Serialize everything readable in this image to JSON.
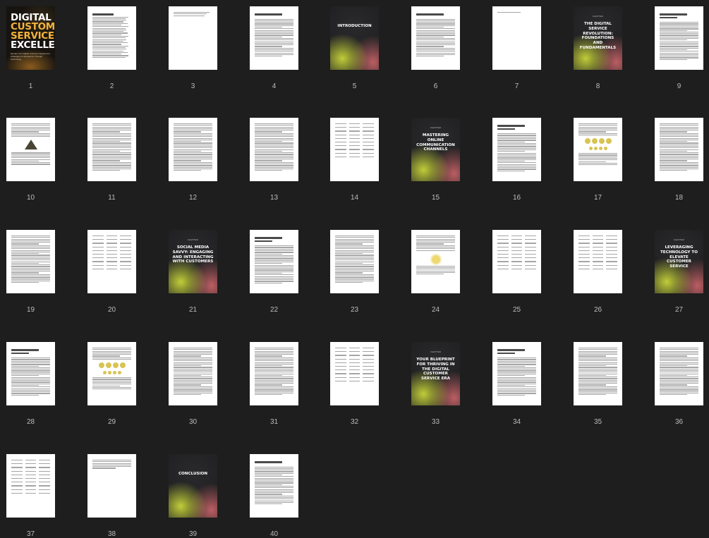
{
  "cover": {
    "title_line1": "DIGITAL",
    "title_line2": "CUSTOMER",
    "title_line3": "SERVICE",
    "title_line4": "EXCELLENCE",
    "subtitle": "Elevate Your Digital Customer Experience: Strategies for Excellence Through Technology"
  },
  "chapter_label": "CHAPTER",
  "pages": [
    {
      "number": "1",
      "kind": "cover"
    },
    {
      "number": "2",
      "kind": "toc",
      "heading": "Table of Contents"
    },
    {
      "number": "3",
      "kind": "toc-cont"
    },
    {
      "number": "4",
      "kind": "text",
      "heading": "Disclaimer"
    },
    {
      "number": "5",
      "kind": "dark",
      "title": "INTRODUCTION"
    },
    {
      "number": "6",
      "kind": "text",
      "heading": "Introduction"
    },
    {
      "number": "7",
      "kind": "blank-line"
    },
    {
      "number": "8",
      "kind": "dark",
      "title": "THE DIGITAL SERVICE REVOLUTION: FOUNDATIONS AND FUNDAMENTALS"
    },
    {
      "number": "9",
      "kind": "text",
      "heading": "The Digital Service Revolution: Foundations and Fundamentals"
    },
    {
      "number": "10",
      "kind": "figure-tri"
    },
    {
      "number": "11",
      "kind": "text"
    },
    {
      "number": "12",
      "kind": "text"
    },
    {
      "number": "13",
      "kind": "text"
    },
    {
      "number": "14",
      "kind": "table"
    },
    {
      "number": "15",
      "kind": "dark",
      "title": "MASTERING ONLINE COMMUNICATION CHANNELS"
    },
    {
      "number": "16",
      "kind": "text",
      "heading": "Mastering Online Communication Channels"
    },
    {
      "number": "17",
      "kind": "figure-dots"
    },
    {
      "number": "18",
      "kind": "text"
    },
    {
      "number": "19",
      "kind": "text"
    },
    {
      "number": "20",
      "kind": "table"
    },
    {
      "number": "21",
      "kind": "dark",
      "title": "SOCIAL MEDIA SAVVY: ENGAGING AND INTERACTING WITH CUSTOMERS"
    },
    {
      "number": "22",
      "kind": "text",
      "heading": "Social Media Savvy: Engaging and Interacting with Customers"
    },
    {
      "number": "23",
      "kind": "text"
    },
    {
      "number": "24",
      "kind": "figure-bulb"
    },
    {
      "number": "25",
      "kind": "table"
    },
    {
      "number": "26",
      "kind": "table"
    },
    {
      "number": "27",
      "kind": "dark",
      "title": "LEVERAGING TECHNOLOGY TO ELEVATE CUSTOMER SERVICE"
    },
    {
      "number": "28",
      "kind": "text",
      "heading": "Leveraging Technology to Elevate Customer Service"
    },
    {
      "number": "29",
      "kind": "figure-dots"
    },
    {
      "number": "30",
      "kind": "text"
    },
    {
      "number": "31",
      "kind": "text"
    },
    {
      "number": "32",
      "kind": "table"
    },
    {
      "number": "33",
      "kind": "dark",
      "title": "YOUR BLUEPRINT FOR THRIVING IN THE DIGITAL CUSTOMER SERVICE ERA"
    },
    {
      "number": "34",
      "kind": "text",
      "heading": "Your Blueprint for Thriving in the Digital Customer Service Era"
    },
    {
      "number": "35",
      "kind": "text"
    },
    {
      "number": "36",
      "kind": "text"
    },
    {
      "number": "37",
      "kind": "table"
    },
    {
      "number": "38",
      "kind": "text-short"
    },
    {
      "number": "39",
      "kind": "dark",
      "title": "CONCLUSION"
    },
    {
      "number": "40",
      "kind": "text",
      "heading": "Conclusion"
    }
  ]
}
